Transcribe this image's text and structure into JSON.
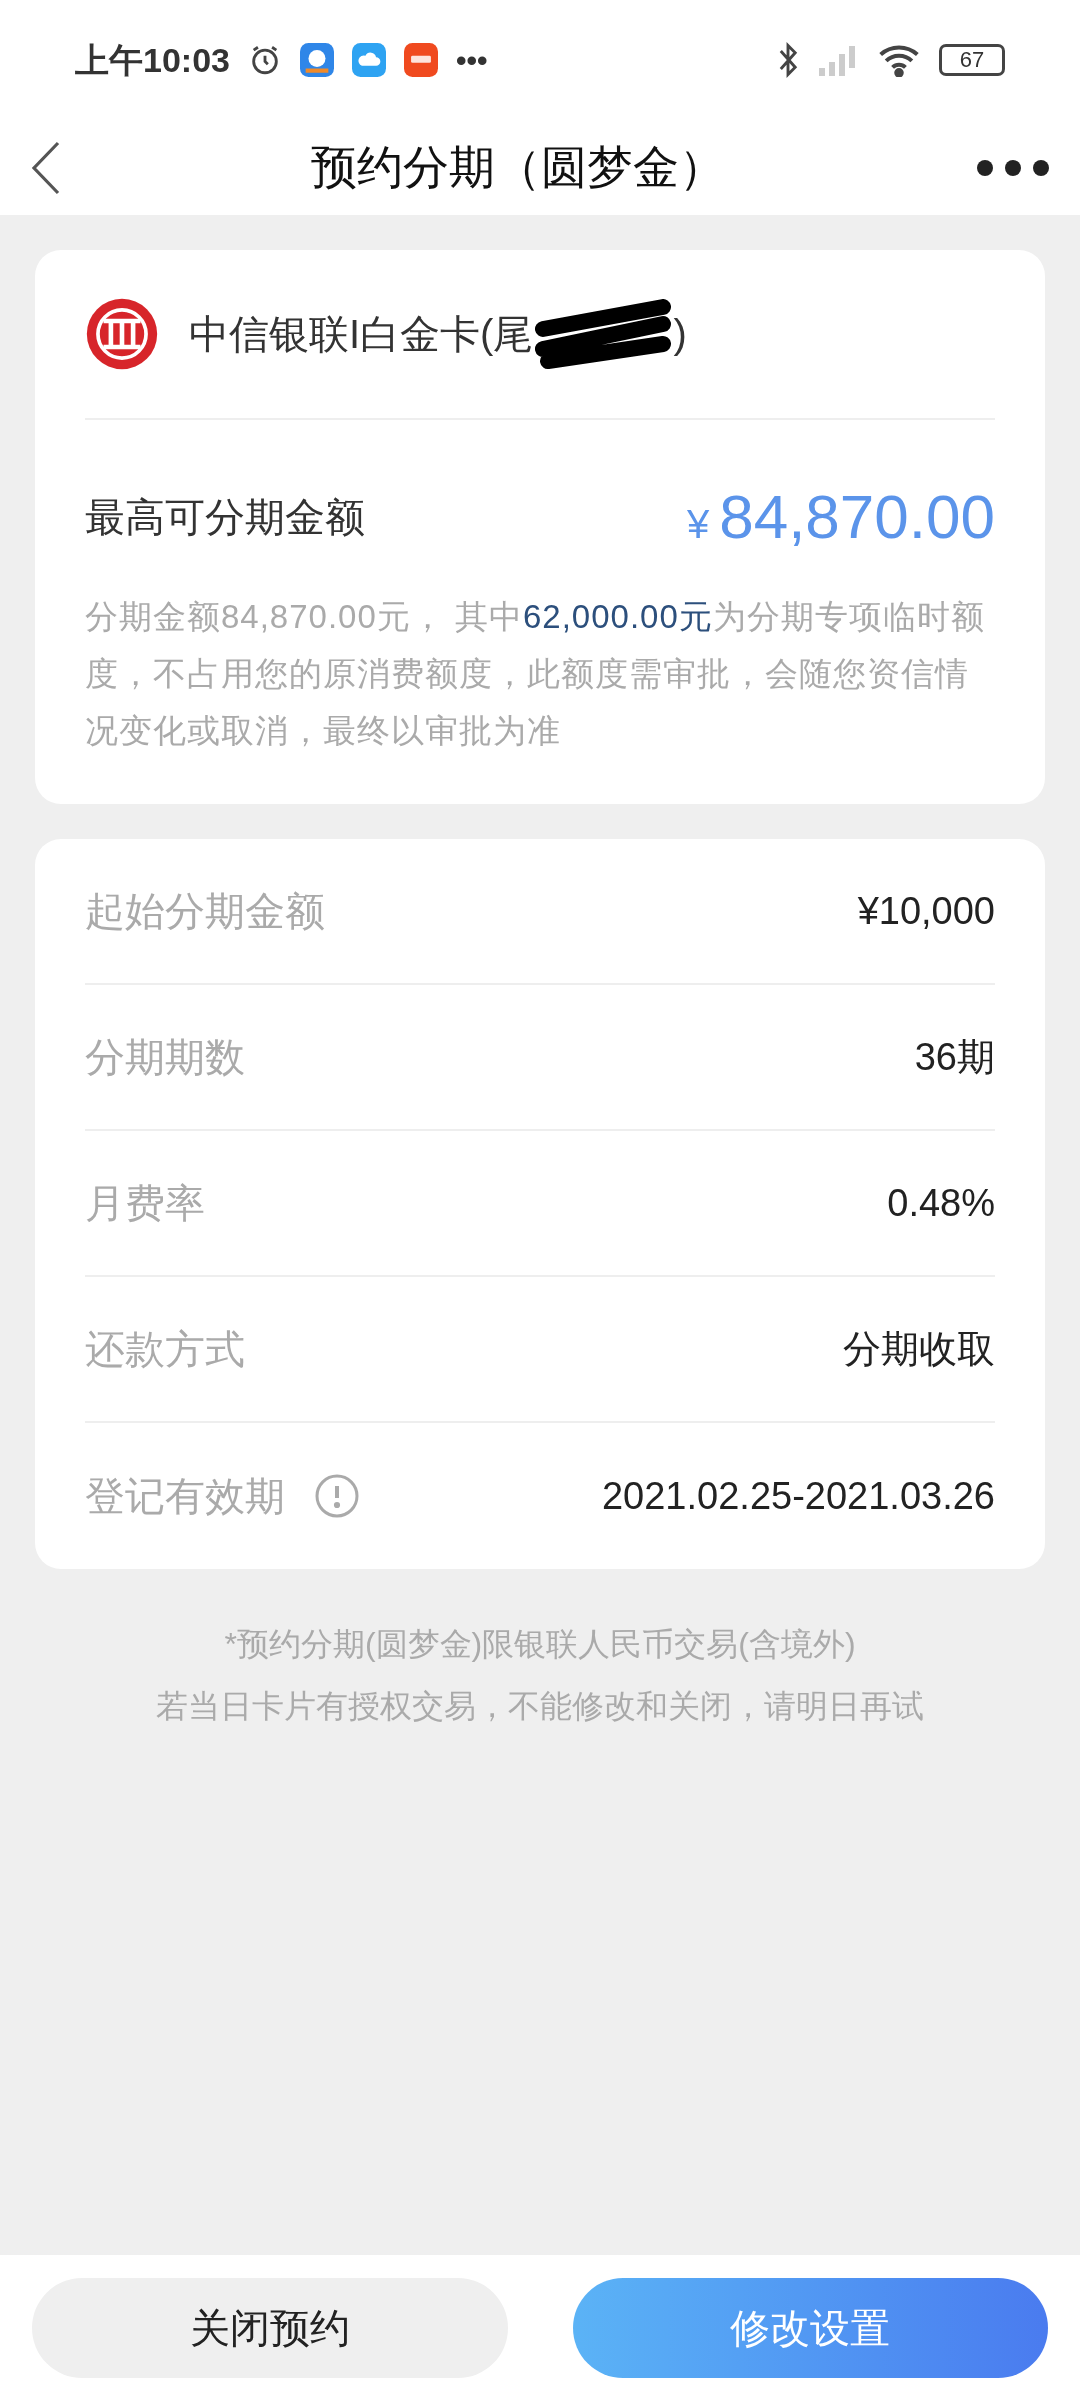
{
  "status_bar": {
    "time": "上午10:03",
    "more": "•••",
    "battery": "67"
  },
  "header": {
    "title": "预约分期（圆梦金）"
  },
  "card": {
    "name": "中信银联I白金卡(尾",
    "name_end": ")",
    "redacted": true,
    "limit_label": "最高可分期金额",
    "currency": "¥",
    "limit_value": "84,870.00",
    "description": [
      {
        "text": "分期金额84,870.00元， 其中",
        "highlight": false
      },
      {
        "text": "62,000.00元",
        "highlight": true
      },
      {
        "text": "为分期专项临时额度，不占用您的原消费额度，此额度需审批，会随您资信情况变化或取消，最终以审批为准",
        "highlight": false
      }
    ]
  },
  "details": [
    {
      "label": "起始分期金额",
      "value": "¥10,000",
      "info": false
    },
    {
      "label": "分期期数",
      "value": "36期",
      "info": false
    },
    {
      "label": "月费率",
      "value": "0.48%",
      "info": false
    },
    {
      "label": "还款方式",
      "value": "分期收取",
      "info": false
    },
    {
      "label": "登记有效期",
      "value": "2021.02.25-2021.03.26",
      "info": true
    }
  ],
  "notes": [
    "*预约分期(圆梦金)限银联人民币交易(含境外)",
    "若当日卡片有授权交易，不能修改和关闭，请明日再试"
  ],
  "buttons": [
    {
      "label": "关闭预约",
      "kind": "secondary"
    },
    {
      "label": "修改设置",
      "kind": "primary"
    }
  ]
}
